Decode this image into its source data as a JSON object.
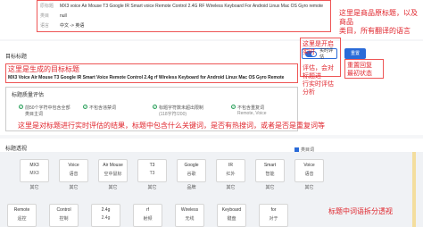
{
  "info": {
    "rows": [
      {
        "key": "原标题",
        "value": "MX3 voice Air Mouse T3 Google IR Smart voice Remote Control 2.4G RF Wireless Keyboard For Android Linux Mac OS Gyro remote"
      },
      {
        "key": "类目",
        "value": "null"
      },
      {
        "key": "语言",
        "value": "中文 -> 英语"
      }
    ]
  },
  "annotations": {
    "top_right": [
      "这里是商品原标题，以及商品",
      "类目，所有翻译的语言"
    ],
    "title_generated": "这里是生成的目标标题",
    "realtime_toggle": "这里是开启实时",
    "realtime_eval": [
      "评估，会对标题进",
      "行实时评估分析"
    ],
    "regenerate": [
      "重置回复",
      "最初状态"
    ],
    "eval_result": "这里是对标题进行实时评估的结果，标题中包含什么关键词，是否有热搜词，或者是否是重复词等",
    "split_view": "标题中词语拆分透视"
  },
  "title_section": {
    "label": "目标标题",
    "title_text": "MX3 Voice Air Mouse T3 Google IR Smart Voice Remote Control 2.4g rf Wireless Keyboard for Android Linux Mac OS Gyro Remote",
    "toggle_label": "实时评估",
    "reset_button": "重置"
  },
  "eval_section": {
    "label": "标题质量评估",
    "items": [
      {
        "text": "前50个字符中包含全部类目主词",
        "sub": ""
      },
      {
        "text": "不包含违禁词",
        "sub": ""
      },
      {
        "text": "标题字符数未超出限制",
        "sub": "(118字符/200)"
      },
      {
        "text": "不包含重复词",
        "sub": "Remote, Voice"
      }
    ]
  },
  "perspective_section": {
    "label": "标题透视",
    "legend": "类目词",
    "row1": [
      {
        "en": "MX3",
        "cn": "MX3",
        "sub": "其它"
      },
      {
        "en": "Voice",
        "cn": "语音",
        "sub": "其它"
      },
      {
        "en": "Air Mouse",
        "cn": "空中鼠标",
        "sub": "其它"
      },
      {
        "en": "T3",
        "cn": "T3",
        "sub": "其它"
      },
      {
        "en": "Google",
        "cn": "谷歌",
        "sub": "品牌"
      },
      {
        "en": "IR",
        "cn": "红外",
        "sub": "其它"
      },
      {
        "en": "Smart",
        "cn": "智能",
        "sub": "其它"
      },
      {
        "en": "Voice",
        "cn": "语音",
        "sub": "其它"
      }
    ],
    "row2": [
      {
        "en": "Remote",
        "cn": "遥控"
      },
      {
        "en": "Control",
        "cn": "控制"
      },
      {
        "en": "2.4g",
        "cn": "2.4g"
      },
      {
        "en": "rf",
        "cn": "射频"
      },
      {
        "en": "Wireless",
        "cn": "无线"
      },
      {
        "en": "Keyboard",
        "cn": "键盘"
      },
      {
        "en": "for",
        "cn": "对于"
      }
    ]
  }
}
